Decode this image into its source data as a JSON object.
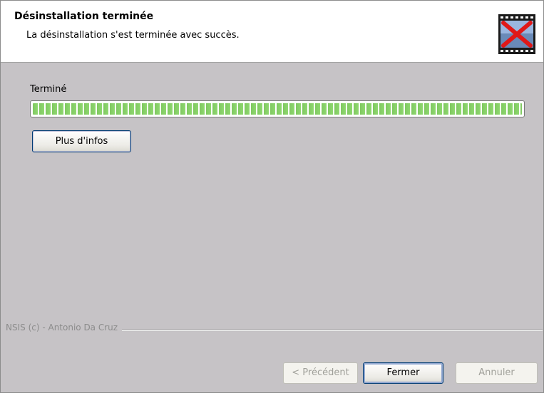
{
  "header": {
    "title": "Désinstallation terminée",
    "subtitle": "La désinstallation s'est terminée avec succès.",
    "icon": "film-uninstall-icon"
  },
  "status": {
    "label": "Terminé",
    "progress": 1.0
  },
  "buttons": {
    "more_info": "Plus d'infos",
    "back": "< Précédent",
    "close": "Fermer",
    "cancel": "Annuler"
  },
  "footer": {
    "brand": "NSIS (c) - Antonio Da Cruz"
  },
  "colors": {
    "progress_fill": "#80c860",
    "accent_border": "#003c74"
  }
}
